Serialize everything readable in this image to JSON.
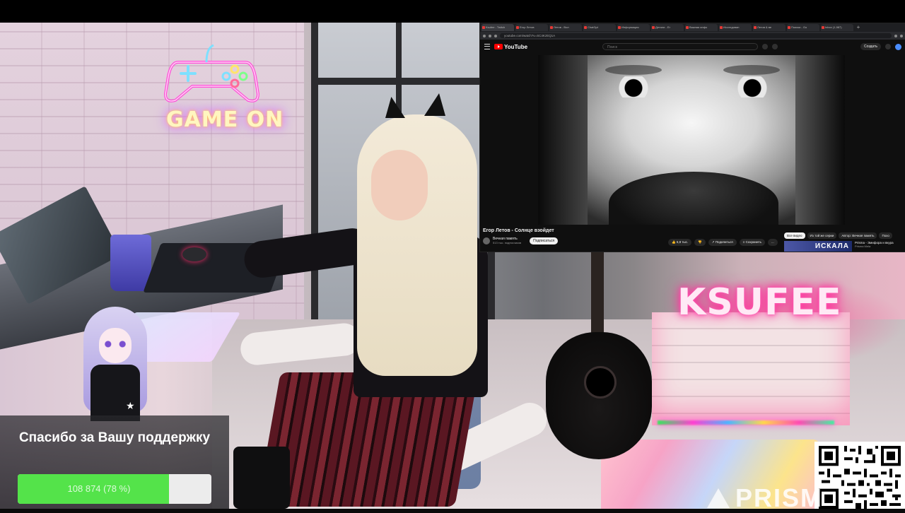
{
  "stream": {
    "neon_sign_left": "GAME ON",
    "neon_sign_right": "KSUFEE",
    "watermark": "PRISM"
  },
  "browser": {
    "tabs": [
      "Ksufee - Twitch",
      "Егор Летов",
      "Летов - Вол",
      "ChatGpt",
      "Информация",
      "Детали - Ег",
      "Важная инфо",
      "Исследован",
      "Летов & ве",
      "Поиски - Go",
      "Inbox (1,987)"
    ],
    "url": "youtube.com/watch?v=SC4KzEQ1A",
    "youtube": {
      "logo": "YouTube",
      "search_placeholder": "Поиск",
      "create_label": "Создать",
      "video_title": "Егор Летов - Солнце взойдет",
      "channel_name": "Вечная память",
      "channel_subs": "513 тыс. подписчиков",
      "subscribe_label": "Подписаться",
      "likes": "6,8 тыс.",
      "share_label": "Поделиться",
      "save_label": "Сохранить",
      "more_label": "...",
      "chips": [
        "Все видео",
        "Из той же серии",
        "Автор: Вечная память",
        "Похо"
      ],
      "suggestion": {
        "thumb_text": "ИСКАЛА",
        "title": "Prisma - Эмифора и вкура",
        "channel": "Prisma Mela"
      }
    }
  },
  "donation": {
    "message": "Спасибо за Вашу поддержку",
    "amount_text": "108 874 (78 %)",
    "percent": 78
  },
  "colors": {
    "progress_fill": "#54e34a",
    "youtube_red": "#ff0000",
    "neon_pink": "#ff2f9a"
  }
}
